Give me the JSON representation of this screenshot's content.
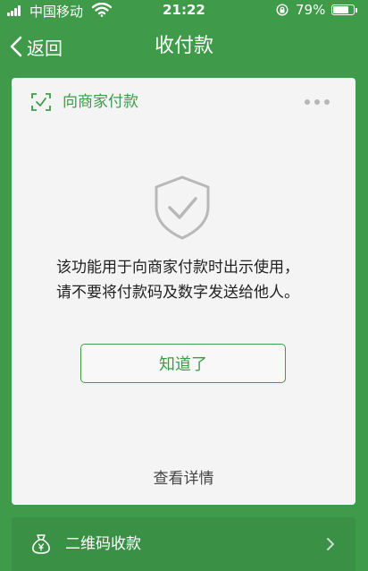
{
  "status_bar": {
    "carrier": "中国移动",
    "time": "21:22",
    "battery": "79%",
    "battery_level": 0.79
  },
  "nav": {
    "back_label": "返回",
    "title": "收付款"
  },
  "card": {
    "title": "向商家付款",
    "warning_text": "该功能用于向商家付款时出示使用，请不要将付款码及数字发送给他人。",
    "ok_button": "知道了",
    "details_link": "查看详情"
  },
  "bottom_row": {
    "label": "二维码收款"
  },
  "colors": {
    "primary": "#3f9a49",
    "card_bg": "#f4f4f4",
    "text": "#222222"
  },
  "icons": [
    "signal-icon",
    "wifi-icon",
    "lock-rotation-icon",
    "battery-icon",
    "back-chevron-icon",
    "scan-icon",
    "more-icon",
    "shield-check-icon",
    "money-bag-icon",
    "chevron-right-icon"
  ]
}
